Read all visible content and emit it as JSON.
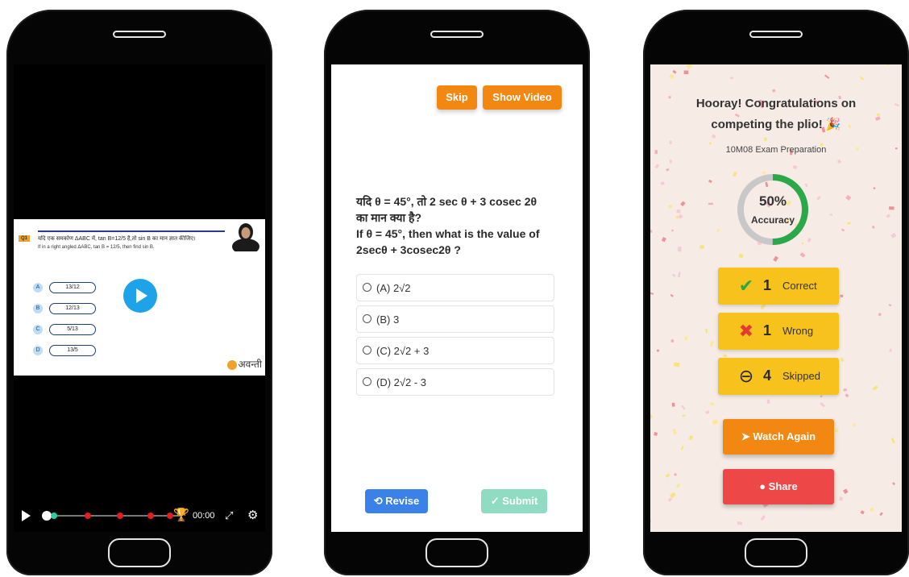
{
  "video_screen": {
    "question_badge": "Q1",
    "question_hindi": "यदि एक समकोण ΔABC में, tan B=12/5 है,तो sin B का मान ज्ञात कीजिए।",
    "question_english": "If in a right angled ΔABC, tan B = 12/5, then find sin B.",
    "options": [
      {
        "letter": "A",
        "text": "13/12"
      },
      {
        "letter": "B",
        "text": "12/13"
      },
      {
        "letter": "C",
        "text": "5/13"
      },
      {
        "letter": "D",
        "text": "13/5"
      }
    ],
    "brand_text": "अवन्ती",
    "time": "00:00",
    "progress": 0.0,
    "marker_colors": {
      "marker": "#e02020",
      "trophy": "#e8a91a"
    }
  },
  "question_screen": {
    "skip_label": "Skip",
    "show_video_label": "Show Video",
    "question_lines": [
      "यदि θ = 45°, तो 2 sec θ + 3 cosec 2θ",
      "का मान क्या है?",
      "If θ = 45°, then what is the value of",
      "2secθ + 3cosec2θ ?"
    ],
    "choices": [
      "(A) 2√2",
      "(B) 3",
      "(C) 2√2 + 3",
      "(D) 2√2 - 3"
    ],
    "revise_label": "⟲ Revise",
    "submit_label": "✓ Submit",
    "colors": {
      "orange": "#f28712",
      "revise": "#3b82e8",
      "submit": "#8fdcc2"
    }
  },
  "result_screen": {
    "title_line1": "Hooray! Congratulations on",
    "title_line2": "competing the plio! 🎉",
    "subtitle": "10M08 Exam Preparation",
    "accuracy_value": "50%",
    "accuracy_label": "Accuracy",
    "accuracy_fraction": 0.5,
    "stats": [
      {
        "icon": "check-icon",
        "glyph": "✔",
        "color": "#2aa84a",
        "count": "1",
        "label": "Correct"
      },
      {
        "icon": "cross-icon",
        "glyph": "✖",
        "color": "#e53935",
        "count": "1",
        "label": "Wrong"
      },
      {
        "icon": "minus-circle-icon",
        "glyph": "⊖",
        "color": "#222222",
        "count": "4",
        "label": "Skipped"
      }
    ],
    "watch_again_label": "➤ Watch Again",
    "share_label": "● Share",
    "colors": {
      "stat_bg": "#f6c21b",
      "watch": "#f28712",
      "share": "#ee4747",
      "ring_green": "#2aa84a",
      "ring_gray": "#c8c8c8"
    }
  }
}
